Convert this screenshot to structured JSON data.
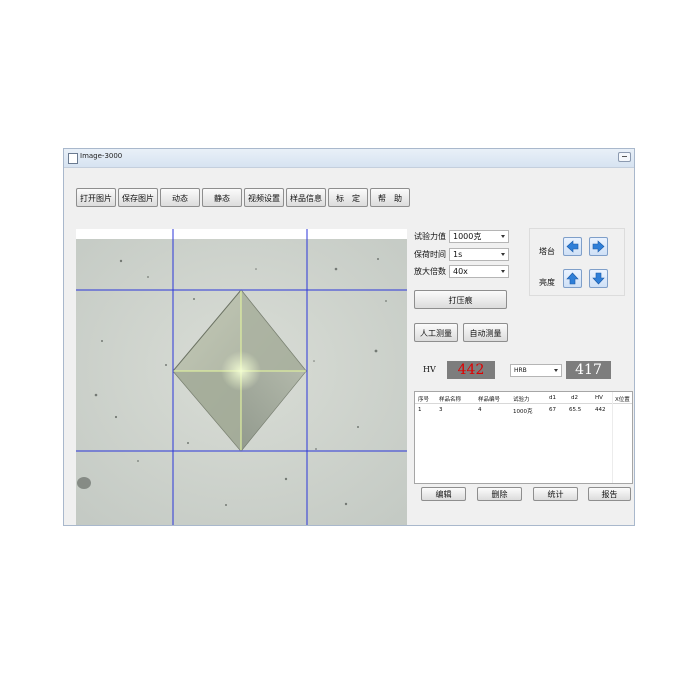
{
  "window": {
    "title": "Image-3000"
  },
  "toolbar": {
    "buttons": [
      "打开图片",
      "保存图片",
      "动态",
      "静态",
      "视频设置",
      "样品信息",
      "标　定",
      "帮　助"
    ]
  },
  "params": {
    "force_label": "试验力值",
    "force_value": "1000克",
    "dwell_label": "保荷时间",
    "dwell_value": "1s",
    "zoom_label": "放大倍数",
    "zoom_value": "40x"
  },
  "actions": {
    "indent": "打压痕",
    "manual": "人工测量",
    "auto": "自动测量"
  },
  "stage": {
    "label": "塔台"
  },
  "brightness": {
    "label": "亮度"
  },
  "hv": {
    "label": "HV",
    "value": "442",
    "scale_select": "HRB",
    "converted": "417"
  },
  "colors": {
    "hv_value": "#e00000",
    "converted_value": "#ffffff",
    "crosshair": "#2b36d9",
    "arrow": "#2f7fd8"
  },
  "icons": [
    "arrow-left-icon",
    "arrow-right-icon",
    "arrow-up-icon",
    "arrow-down-icon"
  ],
  "table": {
    "headers": [
      "序号",
      "样品名称",
      "样品编号",
      "试验力",
      "d1",
      "d2",
      "HV",
      "X位置"
    ],
    "rows": [
      [
        "1",
        "3",
        "4",
        "1000克",
        "67",
        "65.5",
        "442",
        ""
      ]
    ]
  },
  "bottom": {
    "edit": "编辑",
    "delete": "删除",
    "stats": "统计",
    "report": "报告"
  }
}
